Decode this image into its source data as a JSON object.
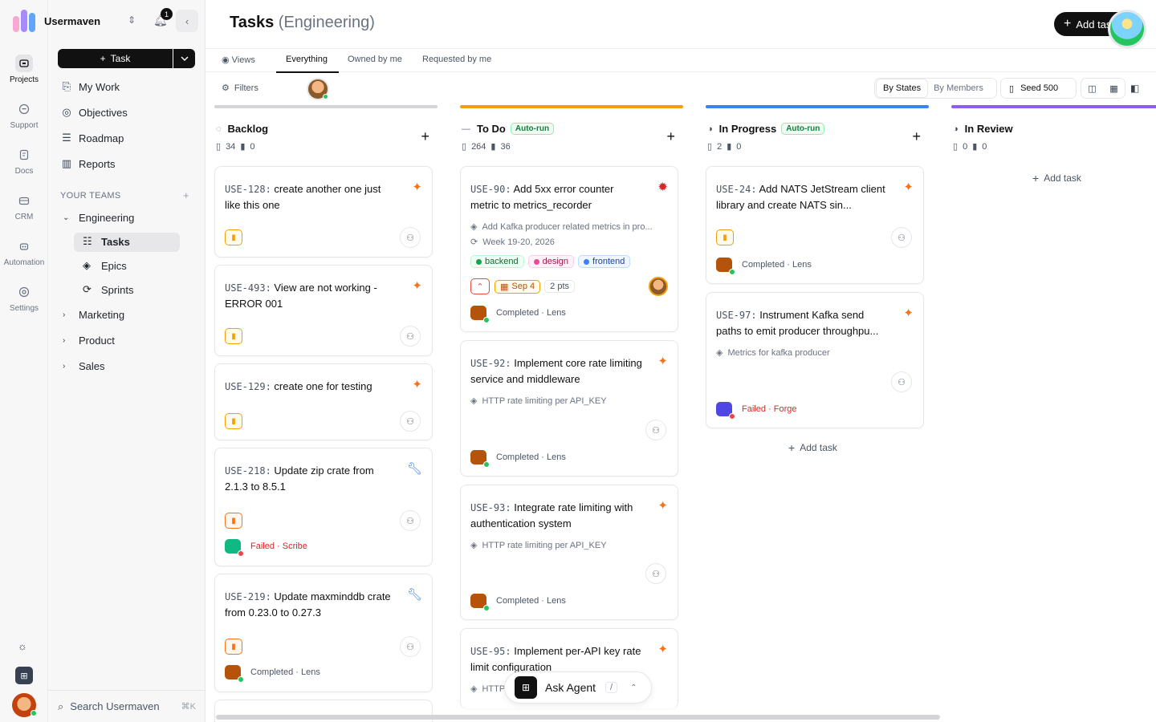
{
  "workspace": {
    "name": "Usermaven",
    "notification_count": "1"
  },
  "rail": [
    {
      "label": "Projects"
    },
    {
      "label": "Support"
    },
    {
      "label": "Docs"
    },
    {
      "label": "CRM"
    },
    {
      "label": "Automation"
    },
    {
      "label": "Settings"
    }
  ],
  "sidebar": {
    "task_button": "Task",
    "nav": [
      {
        "label": "My Work"
      },
      {
        "label": "Objectives"
      },
      {
        "label": "Roadmap"
      },
      {
        "label": "Reports"
      }
    ],
    "teams_header": "YOUR TEAMS",
    "teams": [
      {
        "label": "Engineering"
      },
      {
        "label": "Marketing"
      },
      {
        "label": "Product"
      },
      {
        "label": "Sales"
      }
    ],
    "engineering_children": [
      {
        "label": "Tasks"
      },
      {
        "label": "Epics"
      },
      {
        "label": "Sprints"
      }
    ],
    "search_placeholder": "Search Usermaven",
    "search_shortcut": "⌘K"
  },
  "header": {
    "title": "Tasks",
    "subtitle": "(Engineering)",
    "add_task": "Add task"
  },
  "tabs": [
    {
      "label": "Views"
    },
    {
      "label": "Everything"
    },
    {
      "label": "Owned by me"
    },
    {
      "label": "Requested by me"
    }
  ],
  "toolbar": {
    "filters": "Filters",
    "by_states": "By States",
    "by_members": "By Members",
    "seed": "Seed 500"
  },
  "columns": [
    {
      "title": "Backlog",
      "count": "34",
      "points": "0",
      "color": "#d4d4d8"
    },
    {
      "title": "To Do",
      "count": "264",
      "points": "36",
      "color": "#f59e0b",
      "autorun": "Auto-run"
    },
    {
      "title": "In Progress",
      "count": "2",
      "points": "0",
      "color": "#3b82f6",
      "autorun": "Auto-run"
    },
    {
      "title": "In Review",
      "count": "0",
      "points": "0",
      "color": "#8b5cf6"
    }
  ],
  "cards": {
    "backlog": [
      {
        "key": "USE-128:",
        "title": "create another one just like this one"
      },
      {
        "key": "USE-493:",
        "title": "View are not working - ERROR 001"
      },
      {
        "key": "USE-129:",
        "title": "create one for testing"
      },
      {
        "key": "USE-218:",
        "title": "Update zip crate from 2.1.3 to 8.5.1",
        "agent": "Failed · Scribe"
      },
      {
        "key": "USE-219:",
        "title": "Update maxminddb crate from 0.23.0 to 0.27.3",
        "agent": "Completed · Lens"
      }
    ],
    "todo": [
      {
        "key": "USE-90:",
        "title": "Add 5xx error counter metric to metrics_recorder",
        "epic": "Add Kafka producer related metrics in pro...",
        "sprint": "Week 19-20, 2026",
        "tags": [
          "backend",
          "design",
          "frontend"
        ],
        "date": "Sep 4",
        "points": "2 pts",
        "agent": "Completed · Lens"
      },
      {
        "key": "USE-92:",
        "title": "Implement core rate limiting service and middleware",
        "epic": "HTTP rate limiting per API_KEY",
        "agent": "Completed · Lens"
      },
      {
        "key": "USE-93:",
        "title": "Integrate rate limiting with authentication system",
        "epic": "HTTP rate limiting per API_KEY",
        "agent": "Completed · Lens"
      },
      {
        "key": "USE-95:",
        "title": "Implement per-API key rate limit configuration",
        "epic": "HTTP"
      }
    ],
    "inprogress": [
      {
        "key": "USE-24:",
        "title": "Add NATS JetStream client library and create NATS sin...",
        "agent": "Completed · Lens"
      },
      {
        "key": "USE-97:",
        "title": "Instrument Kafka send paths to emit producer throughpu...",
        "epic": "Metrics for kafka producer",
        "agent": "Failed · Forge"
      }
    ]
  },
  "add_task_label": "Add task",
  "ask_agent": {
    "label": "Ask Agent",
    "shortcut": "/"
  }
}
